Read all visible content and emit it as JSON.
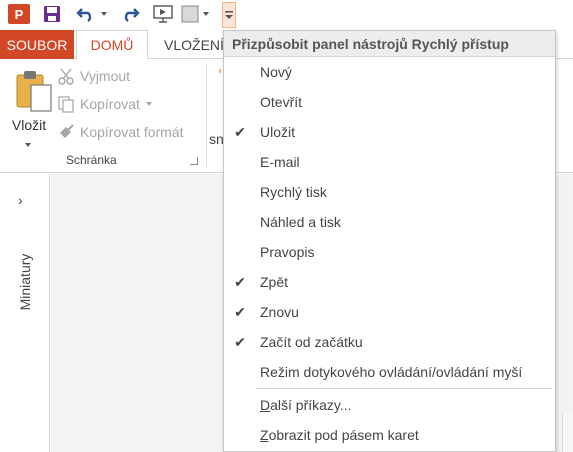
{
  "qat": {
    "app_badge": "P",
    "icons": [
      "powerpoint-logo-icon",
      "save-icon",
      "undo-icon",
      "redo-icon",
      "start-from-beginning-icon",
      "shape-icon",
      "customize-qat-icon"
    ]
  },
  "tabs": {
    "file": "SOUBOR",
    "home": "DOMŮ",
    "insert": "VLOŽENÍ"
  },
  "clipboard": {
    "paste": "Vložit",
    "cut": "Vyjmout",
    "copy": "Kopírovat",
    "format_painter": "Kopírovat formát",
    "group_label": "Schránka",
    "partial_next": "sn"
  },
  "thumbnails": {
    "label": "Miniatury",
    "expand": "›"
  },
  "dropdown": {
    "title": "Přizpůsobit panel nástrojů Rychlý přístup",
    "items": [
      {
        "label": "Nový",
        "checked": false
      },
      {
        "label": "Otevřít",
        "checked": false
      },
      {
        "label": "Uložit",
        "checked": true
      },
      {
        "label": "E-mail",
        "checked": false
      },
      {
        "label": "Rychlý tisk",
        "checked": false
      },
      {
        "label": "Náhled a tisk",
        "checked": false
      },
      {
        "label": "Pravopis",
        "checked": false
      },
      {
        "label": "Zpět",
        "checked": true
      },
      {
        "label": "Znovu",
        "checked": true
      },
      {
        "label": "Začít od začátku",
        "checked": true
      },
      {
        "label": "Režim dotykového ovládání/ovládání myší",
        "checked": false
      }
    ],
    "more_commands": "Další příkazy...",
    "show_below": "Zobrazit pod pásem karet",
    "check_glyph": "✔"
  },
  "colors": {
    "accent": "#d24726",
    "dropdown_header": "#ededed",
    "disabled_text": "#a5a5a5"
  }
}
